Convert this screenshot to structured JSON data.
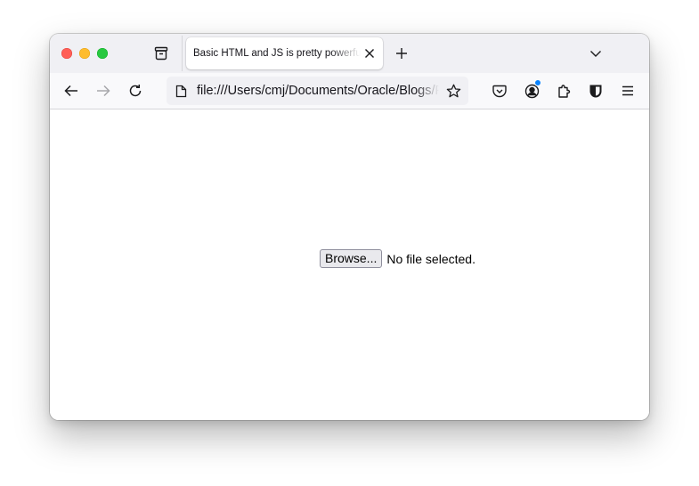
{
  "window": {
    "tab": {
      "title": "Basic HTML and JS is pretty powerful",
      "close_icon": "close-icon"
    },
    "tabbar_icons": [
      "firefox-view-icon",
      "new-tab-plus-icon",
      "list-all-tabs-chevron-icon"
    ],
    "navbar": {
      "back_icon": "back-arrow-icon",
      "forward_icon": "forward-arrow-icon",
      "reload_icon": "reload-icon",
      "url": "file:///Users/cmj/Documents/Oracle/Blogs/Playground/index.html",
      "page_icon": "document-icon",
      "bookmark_icon": "star-icon",
      "toolbar_icons": [
        "pocket-icon",
        "account-icon",
        "extensions-icon",
        "bitwarden-icon",
        "menu-icon"
      ]
    }
  },
  "page": {
    "file_input": {
      "button_label": "Browse...",
      "status_text": "No file selected."
    }
  },
  "colors": {
    "tabbar_bg": "#f0f0f4",
    "navbar_bg": "#f9f9fb",
    "urlbar_bg": "#f0f0f4",
    "close_dot": "#ff5f57",
    "minimize_dot": "#febc2e",
    "maximize_dot": "#28c840",
    "notification_dot": "#0a84ff"
  }
}
